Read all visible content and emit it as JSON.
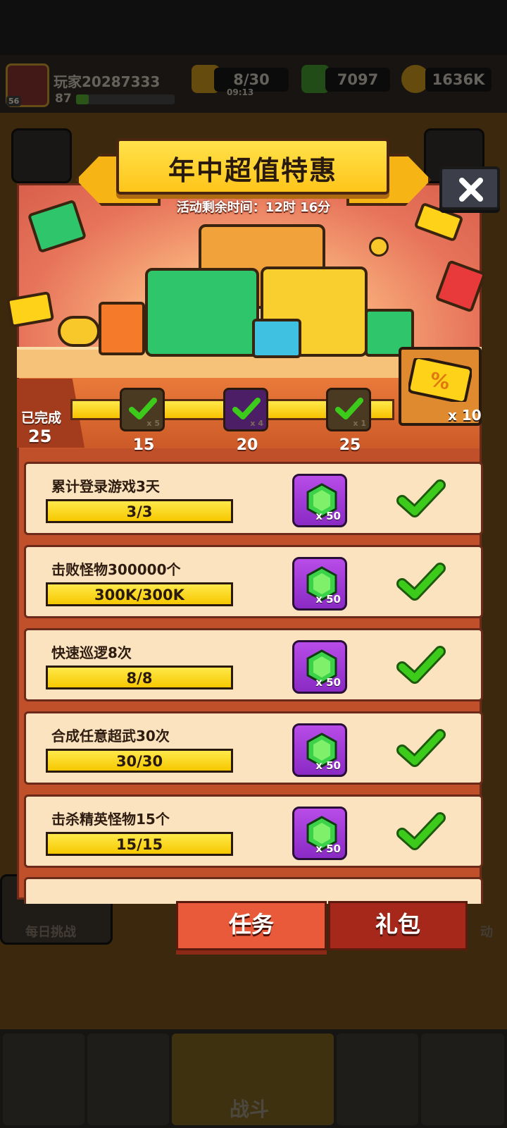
{
  "player": {
    "name": "玩家20287333",
    "level": "87",
    "badge_level": "56"
  },
  "resources": {
    "energy": "8/30",
    "energy_timer": "09:13",
    "gems": "7097",
    "coins": "1636K"
  },
  "background": {
    "daily_challenge": "每日挑战",
    "event_partial": "动",
    "battle": "战斗"
  },
  "event": {
    "title": "年中超值特惠",
    "countdown": "活动剩余时间：12时 16分",
    "completed_label": "已完成",
    "completed_value": "25",
    "milestones": [
      {
        "points": "15",
        "mini": "x 5"
      },
      {
        "points": "20",
        "mini": "x 4"
      },
      {
        "points": "25",
        "mini": "x 1"
      }
    ],
    "final_reward_count": "x 10"
  },
  "tasks": [
    {
      "name": "累计登录游戏3天",
      "progress_text": "3/3",
      "progress": 1.0,
      "reward_qty": "x 50"
    },
    {
      "name": "击败怪物300000个",
      "progress_text": "300K/300K",
      "progress": 1.0,
      "reward_qty": "x 50"
    },
    {
      "name": "快速巡逻8次",
      "progress_text": "8/8",
      "progress": 1.0,
      "reward_qty": "x 50"
    },
    {
      "name": "合成任意超武30次",
      "progress_text": "30/30",
      "progress": 1.0,
      "reward_qty": "x 50"
    },
    {
      "name": "击杀精英怪物15个",
      "progress_text": "15/15",
      "progress": 1.0,
      "reward_qty": "x 50"
    }
  ],
  "tabs": {
    "tasks": "任务",
    "gifts": "礼包"
  },
  "colors": {
    "accent_yellow": "#ffd21a",
    "reward_purple": "#a040d8",
    "check_green": "#3ccb1a",
    "panel_red": "#c0502a"
  },
  "icons": {
    "energy": "lightning-icon",
    "gems": "gem-icon",
    "coins": "coin-icon",
    "close": "close-icon",
    "reward": "gem-icon",
    "complete": "checkmark-icon"
  }
}
